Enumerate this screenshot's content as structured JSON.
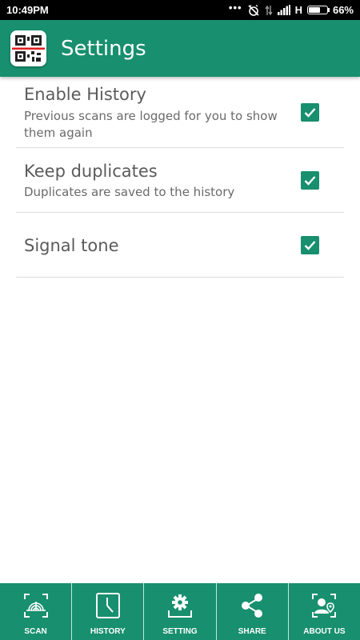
{
  "status_bar": {
    "time": "10:49PM",
    "dots": "•••",
    "network": "H",
    "battery": "66%",
    "battery_level": 0.66
  },
  "app_bar": {
    "title": "Settings",
    "logo_icon": "qr-code-scanner-icon"
  },
  "settings": [
    {
      "title": "Enable History",
      "description": "Previous scans are logged for you to show them again",
      "checked": true
    },
    {
      "title": "Keep duplicates",
      "description": "Duplicates are saved to the history",
      "checked": true
    },
    {
      "title": "Signal tone",
      "description": "",
      "checked": true
    }
  ],
  "bottom_nav": [
    {
      "label": "SCAN",
      "icon": "scan-icon"
    },
    {
      "label": "HISTORY",
      "icon": "clock-icon"
    },
    {
      "label": "SETTING",
      "icon": "gear-icon"
    },
    {
      "label": "SHARE",
      "icon": "share-icon"
    },
    {
      "label": "ABOUT US",
      "icon": "contact-icon"
    }
  ],
  "colors": {
    "primary": "#188f6e",
    "status_bar": "#000000",
    "text": "#5b5b5b"
  }
}
